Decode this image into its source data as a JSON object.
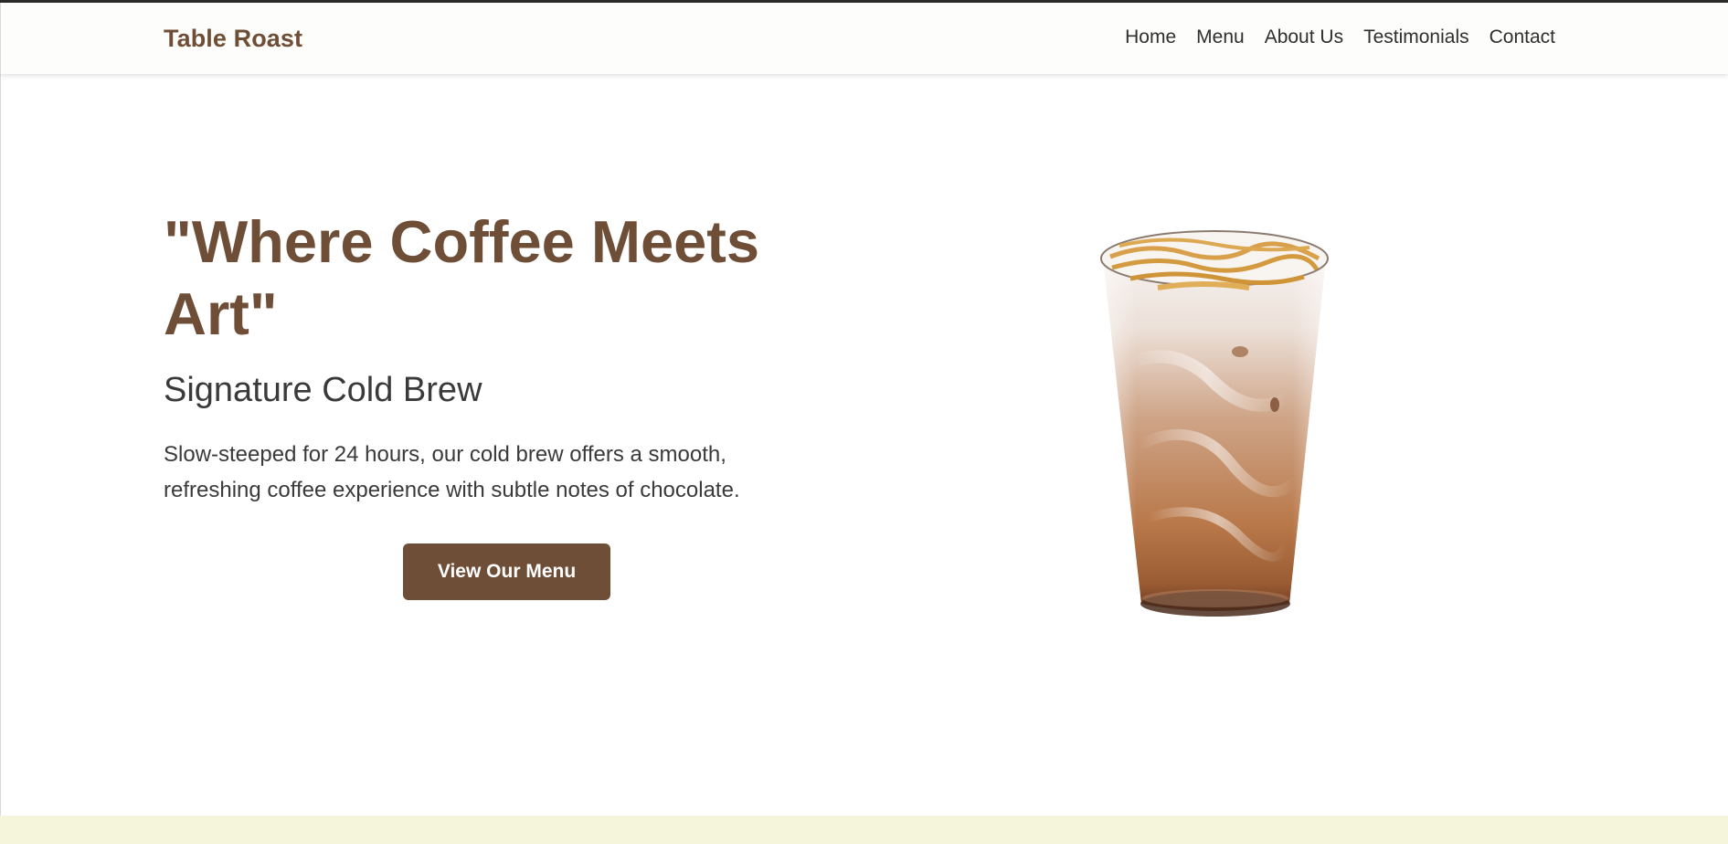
{
  "brand": {
    "name": "Table Roast"
  },
  "nav": {
    "items": [
      {
        "label": "Home"
      },
      {
        "label": "Menu"
      },
      {
        "label": "About Us"
      },
      {
        "label": "Testimonials"
      },
      {
        "label": "Contact"
      }
    ]
  },
  "hero": {
    "title": "\"Where Coffee Meets Art\"",
    "subtitle": "Signature Cold Brew",
    "description": "Slow-steeped for 24 hours, our cold brew offers a smooth, refreshing coffee experience with subtle notes of chocolate.",
    "cta_label": "View Our Menu",
    "image_alt": "iced-coffee-glass"
  },
  "colors": {
    "brand": "#6f4e37",
    "text": "#3a3a3a",
    "nav_bg": "#fdfdfb",
    "footer_bg": "#f5f5dc"
  }
}
